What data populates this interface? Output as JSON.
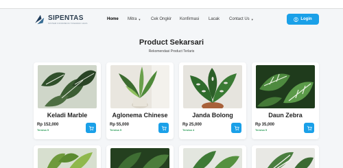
{
  "brand": {
    "name": "SIPENTAS",
    "tagline": "SISTEM INFORMASI TANAMAN HIAS"
  },
  "nav": [
    {
      "label": "Home",
      "active": true,
      "dropdown": false
    },
    {
      "label": "Mitra",
      "active": false,
      "dropdown": true
    },
    {
      "label": "Cek Ongkir",
      "active": false,
      "dropdown": false
    },
    {
      "label": "Konfirmasi",
      "active": false,
      "dropdown": false
    },
    {
      "label": "Lacak",
      "active": false,
      "dropdown": false
    },
    {
      "label": "Contact Us",
      "active": false,
      "dropdown": true
    }
  ],
  "login": {
    "label": "Login",
    "icon": "user-icon"
  },
  "page": {
    "title": "Product Sekarsari",
    "subtitle": "Rekomendasi Product Terlaris"
  },
  "products": [
    {
      "name": "Keladi Marble",
      "price": "Rp 152,000",
      "stock": "Tersisa 5"
    },
    {
      "name": "Aglonema Chinese",
      "price": "Rp 55,000",
      "stock": "Tersisa 5"
    },
    {
      "name": "Janda Bolong",
      "price": "Rp 25,000",
      "stock": "Tersisa 4"
    },
    {
      "name": "Daun Zebra",
      "price": "Rp 35,000",
      "stock": "Tersisa 5"
    }
  ],
  "colors": {
    "accent": "#1aa0e8",
    "stock": "#2e9d5a",
    "background": "#f4f6f8"
  },
  "icons": {
    "cart": "cart-icon",
    "logo": "leaf-logo-icon"
  }
}
